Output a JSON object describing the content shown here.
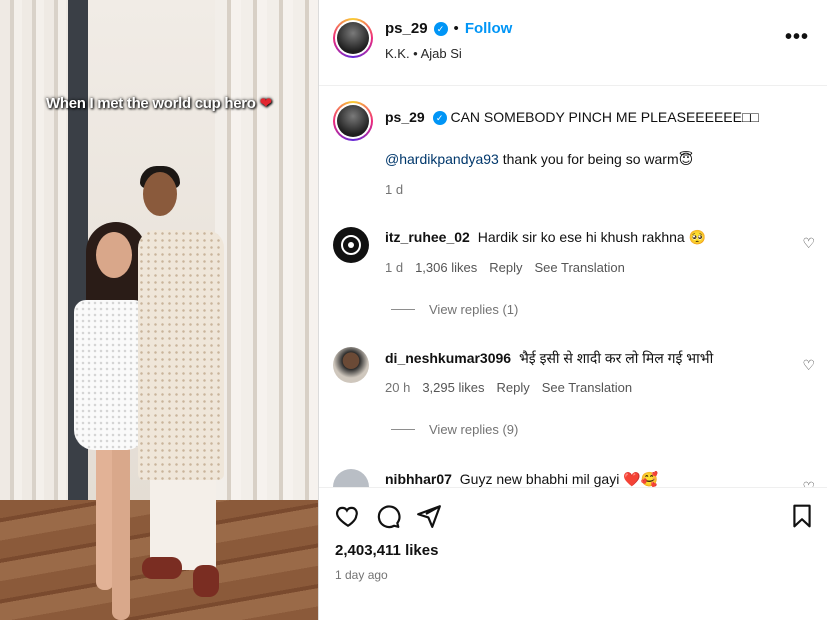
{
  "media": {
    "caption": "When I met the world cup hero",
    "caption_emoji": "❤"
  },
  "header": {
    "username": "ps_29",
    "verified_icon": "verified-badge-icon",
    "separator": "•",
    "follow_label": "Follow",
    "subtitle": "K.K. • Ajab Si",
    "more_label": "•••"
  },
  "post_caption": {
    "username": "ps_29",
    "text": "CAN SOMEBODY PINCH ME PLEASEEEEEE□□",
    "mention": "@hardikpandya93",
    "text2": "thank you for being so warm",
    "emoji": "😇",
    "time": "1 d"
  },
  "comments": [
    {
      "username": "itz_ruhee_02",
      "text": "Hardik sir ko ese hi khush rakhna",
      "emoji": "🥺",
      "time": "1 d",
      "likes": "1,306 likes",
      "reply": "Reply",
      "translate": "See Translation",
      "view_replies": "View replies (1)"
    },
    {
      "username": "di_neshkumar3096",
      "text": "भैई इसी से शादी कर लो मिल गई भाभी",
      "time": "20 h",
      "likes": "3,295 likes",
      "reply": "Reply",
      "translate": "See Translation",
      "view_replies": "View replies (9)"
    },
    {
      "username": "nibhhar07",
      "text": "Guyz new bhabhi mil gayi",
      "emoji": "❤️🥰"
    }
  ],
  "actions": {
    "like_icon": "heart-icon",
    "comment_icon": "comment-icon",
    "share_icon": "share-icon",
    "save_icon": "bookmark-icon",
    "likes": "2,403,411 likes",
    "time_ago": "1 day ago"
  },
  "colors": {
    "accent": "#0095f6",
    "muted": "#737373",
    "mention": "#00376b"
  }
}
